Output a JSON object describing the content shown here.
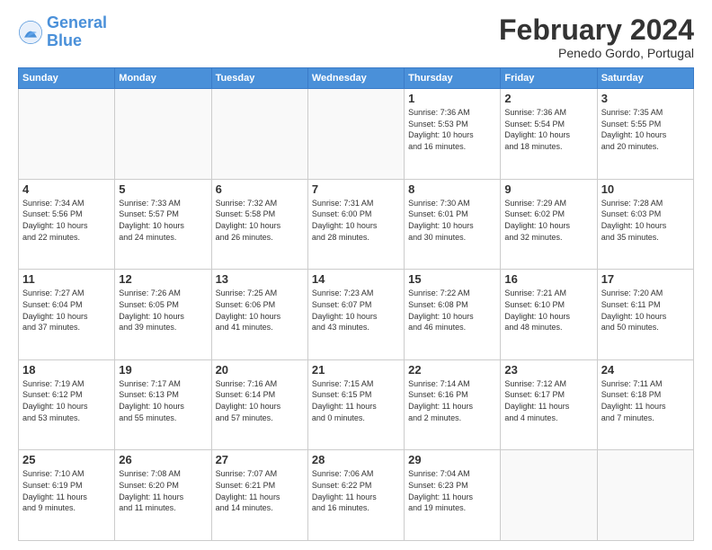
{
  "header": {
    "logo_general": "General",
    "logo_blue": "Blue",
    "title": "February 2024",
    "subtitle": "Penedo Gordo, Portugal"
  },
  "days_of_week": [
    "Sunday",
    "Monday",
    "Tuesday",
    "Wednesday",
    "Thursday",
    "Friday",
    "Saturday"
  ],
  "weeks": [
    [
      {
        "day": "",
        "info": ""
      },
      {
        "day": "",
        "info": ""
      },
      {
        "day": "",
        "info": ""
      },
      {
        "day": "",
        "info": ""
      },
      {
        "day": "1",
        "info": "Sunrise: 7:36 AM\nSunset: 5:53 PM\nDaylight: 10 hours\nand 16 minutes."
      },
      {
        "day": "2",
        "info": "Sunrise: 7:36 AM\nSunset: 5:54 PM\nDaylight: 10 hours\nand 18 minutes."
      },
      {
        "day": "3",
        "info": "Sunrise: 7:35 AM\nSunset: 5:55 PM\nDaylight: 10 hours\nand 20 minutes."
      }
    ],
    [
      {
        "day": "4",
        "info": "Sunrise: 7:34 AM\nSunset: 5:56 PM\nDaylight: 10 hours\nand 22 minutes."
      },
      {
        "day": "5",
        "info": "Sunrise: 7:33 AM\nSunset: 5:57 PM\nDaylight: 10 hours\nand 24 minutes."
      },
      {
        "day": "6",
        "info": "Sunrise: 7:32 AM\nSunset: 5:58 PM\nDaylight: 10 hours\nand 26 minutes."
      },
      {
        "day": "7",
        "info": "Sunrise: 7:31 AM\nSunset: 6:00 PM\nDaylight: 10 hours\nand 28 minutes."
      },
      {
        "day": "8",
        "info": "Sunrise: 7:30 AM\nSunset: 6:01 PM\nDaylight: 10 hours\nand 30 minutes."
      },
      {
        "day": "9",
        "info": "Sunrise: 7:29 AM\nSunset: 6:02 PM\nDaylight: 10 hours\nand 32 minutes."
      },
      {
        "day": "10",
        "info": "Sunrise: 7:28 AM\nSunset: 6:03 PM\nDaylight: 10 hours\nand 35 minutes."
      }
    ],
    [
      {
        "day": "11",
        "info": "Sunrise: 7:27 AM\nSunset: 6:04 PM\nDaylight: 10 hours\nand 37 minutes."
      },
      {
        "day": "12",
        "info": "Sunrise: 7:26 AM\nSunset: 6:05 PM\nDaylight: 10 hours\nand 39 minutes."
      },
      {
        "day": "13",
        "info": "Sunrise: 7:25 AM\nSunset: 6:06 PM\nDaylight: 10 hours\nand 41 minutes."
      },
      {
        "day": "14",
        "info": "Sunrise: 7:23 AM\nSunset: 6:07 PM\nDaylight: 10 hours\nand 43 minutes."
      },
      {
        "day": "15",
        "info": "Sunrise: 7:22 AM\nSunset: 6:08 PM\nDaylight: 10 hours\nand 46 minutes."
      },
      {
        "day": "16",
        "info": "Sunrise: 7:21 AM\nSunset: 6:10 PM\nDaylight: 10 hours\nand 48 minutes."
      },
      {
        "day": "17",
        "info": "Sunrise: 7:20 AM\nSunset: 6:11 PM\nDaylight: 10 hours\nand 50 minutes."
      }
    ],
    [
      {
        "day": "18",
        "info": "Sunrise: 7:19 AM\nSunset: 6:12 PM\nDaylight: 10 hours\nand 53 minutes."
      },
      {
        "day": "19",
        "info": "Sunrise: 7:17 AM\nSunset: 6:13 PM\nDaylight: 10 hours\nand 55 minutes."
      },
      {
        "day": "20",
        "info": "Sunrise: 7:16 AM\nSunset: 6:14 PM\nDaylight: 10 hours\nand 57 minutes."
      },
      {
        "day": "21",
        "info": "Sunrise: 7:15 AM\nSunset: 6:15 PM\nDaylight: 11 hours\nand 0 minutes."
      },
      {
        "day": "22",
        "info": "Sunrise: 7:14 AM\nSunset: 6:16 PM\nDaylight: 11 hours\nand 2 minutes."
      },
      {
        "day": "23",
        "info": "Sunrise: 7:12 AM\nSunset: 6:17 PM\nDaylight: 11 hours\nand 4 minutes."
      },
      {
        "day": "24",
        "info": "Sunrise: 7:11 AM\nSunset: 6:18 PM\nDaylight: 11 hours\nand 7 minutes."
      }
    ],
    [
      {
        "day": "25",
        "info": "Sunrise: 7:10 AM\nSunset: 6:19 PM\nDaylight: 11 hours\nand 9 minutes."
      },
      {
        "day": "26",
        "info": "Sunrise: 7:08 AM\nSunset: 6:20 PM\nDaylight: 11 hours\nand 11 minutes."
      },
      {
        "day": "27",
        "info": "Sunrise: 7:07 AM\nSunset: 6:21 PM\nDaylight: 11 hours\nand 14 minutes."
      },
      {
        "day": "28",
        "info": "Sunrise: 7:06 AM\nSunset: 6:22 PM\nDaylight: 11 hours\nand 16 minutes."
      },
      {
        "day": "29",
        "info": "Sunrise: 7:04 AM\nSunset: 6:23 PM\nDaylight: 11 hours\nand 19 minutes."
      },
      {
        "day": "",
        "info": ""
      },
      {
        "day": "",
        "info": ""
      }
    ]
  ]
}
